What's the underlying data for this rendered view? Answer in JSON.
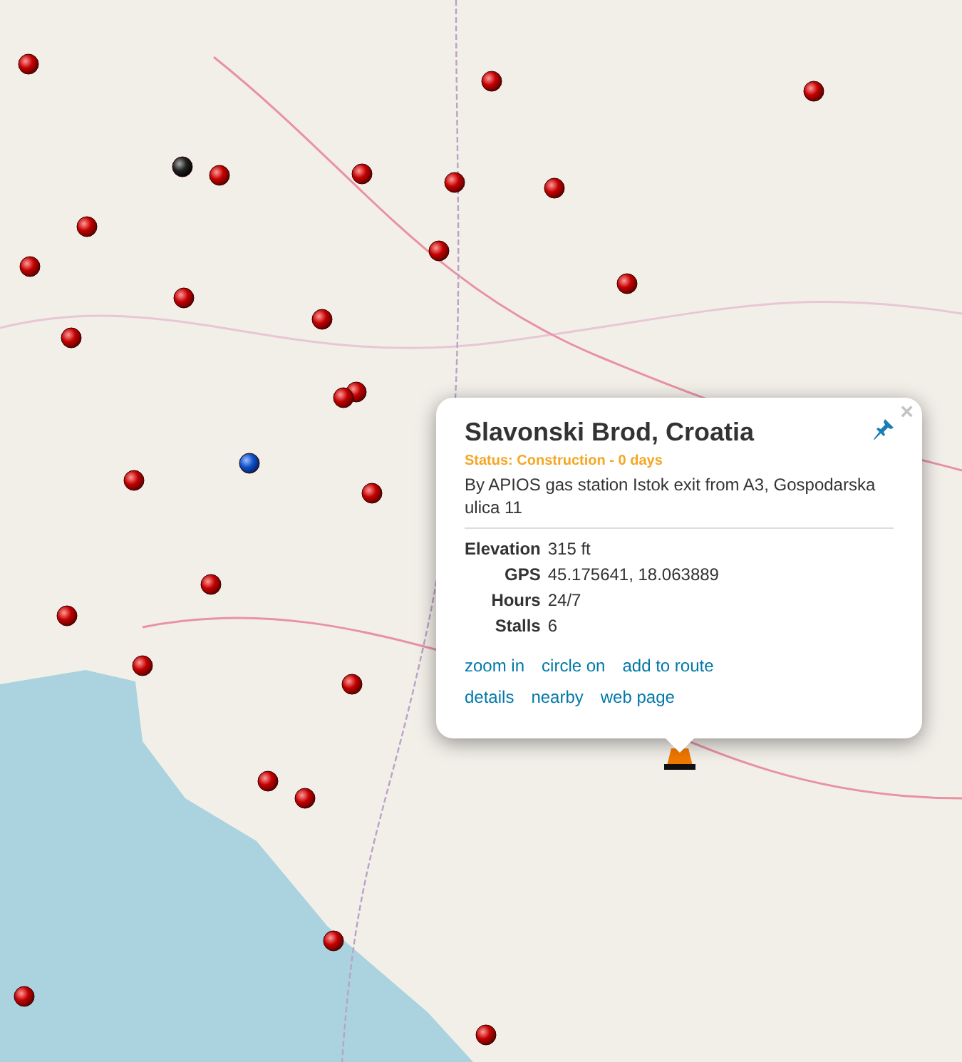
{
  "popup": {
    "title": "Slavonski Brod, Croatia",
    "status": "Status: Construction - 0 days",
    "address": "By APIOS gas station Istok exit from A3, Gospodarska ulica 11",
    "details": [
      {
        "label": "Elevation",
        "value": "315 ft"
      },
      {
        "label": "GPS",
        "value": "45.175641, 18.063889"
      },
      {
        "label": "Hours",
        "value": "24/7"
      },
      {
        "label": "Stalls",
        "value": "6"
      }
    ],
    "link_rows": [
      [
        "zoom in",
        "circle on",
        "add to route"
      ],
      [
        "details",
        "nearby",
        "web page"
      ]
    ],
    "close": "×"
  }
}
